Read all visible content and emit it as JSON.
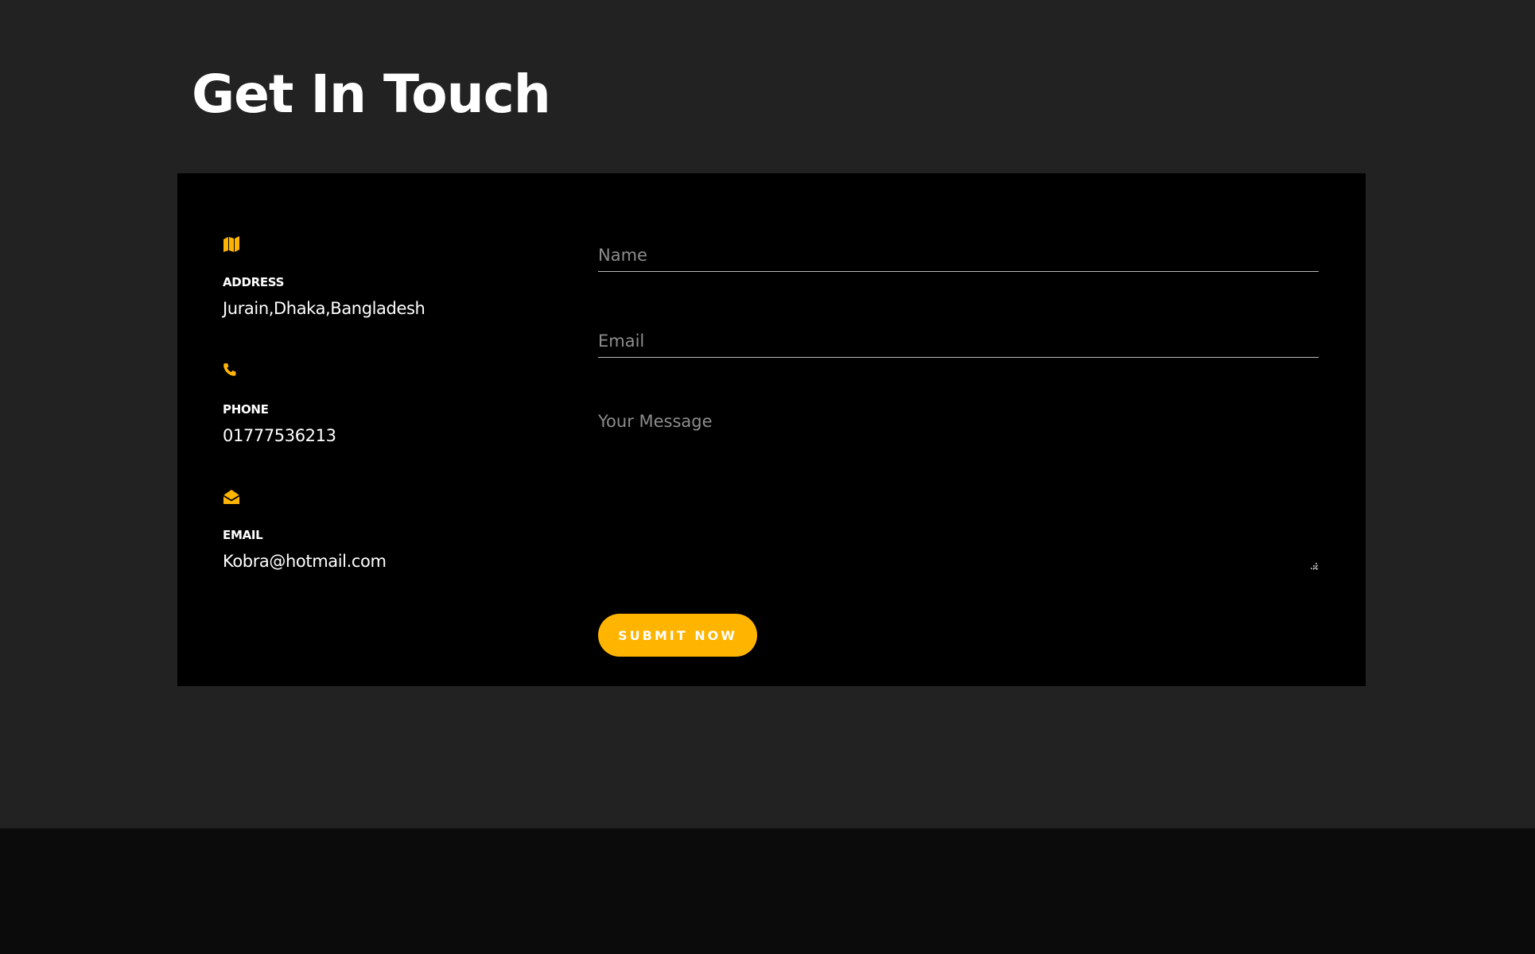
{
  "header": {
    "title": "Get In Touch"
  },
  "contact_info": {
    "address": {
      "icon": "map-icon",
      "label": "ADDRESS",
      "value": "Jurain,Dhaka,Bangladesh"
    },
    "phone": {
      "icon": "phone-icon",
      "label": "PHONE",
      "value": "01777536213"
    },
    "email": {
      "icon": "envelope-open-icon",
      "label": "EMAIL",
      "value": "Kobra@hotmail.com"
    }
  },
  "form": {
    "name_placeholder": "Name",
    "name_value": "",
    "email_placeholder": "Email",
    "email_value": "",
    "message_placeholder": "Your Message",
    "message_value": "",
    "submit_label": "SUBMIT NOW"
  },
  "colors": {
    "accent": "#ffb400",
    "section_background": "#222222",
    "card_background": "#000000",
    "footer_background": "#0b0b0b",
    "text": "#ffffff",
    "placeholder": "#8d8d8d"
  }
}
